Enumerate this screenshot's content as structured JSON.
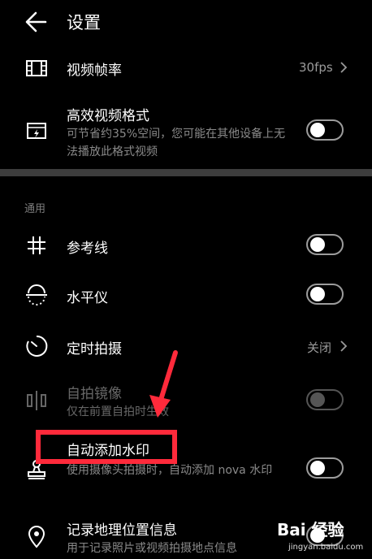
{
  "header": {
    "title": "设置",
    "back_icon": "arrow-left-icon"
  },
  "camera_rows": [
    {
      "key": "frame_rate",
      "label": "视频帧率",
      "value": "30fps",
      "icon": "film-strip-icon"
    },
    {
      "key": "efficient_format",
      "label": "高效视频格式",
      "description": "可节省约35%空间，您可能在其他设备上无法播放此格式视频",
      "toggle": false,
      "icon": "video-format-icon"
    }
  ],
  "general": {
    "section_title": "通用",
    "rows": [
      {
        "key": "grid",
        "label": "参考线",
        "toggle": false,
        "icon": "grid-icon"
      },
      {
        "key": "level",
        "label": "水平仪",
        "toggle": false,
        "icon": "level-icon"
      },
      {
        "key": "timer",
        "label": "定时拍摄",
        "value": "关闭",
        "icon": "timer-icon"
      },
      {
        "key": "mirror",
        "label": "自拍镜像",
        "description": "仅在前置自拍时生效",
        "toggle": false,
        "disabled": true,
        "icon": "mirror-icon"
      },
      {
        "key": "watermark",
        "label": "自动添加水印",
        "description": "使用摄像头拍摄时，自动添加 nova 水印",
        "toggle": false,
        "icon": "stamp-icon"
      },
      {
        "key": "location",
        "label": "记录地理位置信息",
        "description": "用于记录照片或视频拍摄地点信息",
        "toggle": false,
        "icon": "location-pin-icon"
      }
    ]
  },
  "overlay": {
    "highlight_color": "#ff2a3b",
    "watermark_text": "Bai 经验",
    "watermark_url": "jingyan.baidu.com"
  }
}
